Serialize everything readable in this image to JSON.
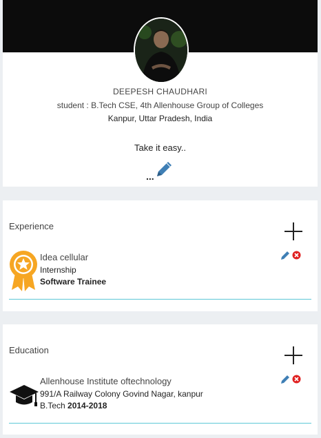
{
  "profile": {
    "name": "DEEPESH CHAUDHARI",
    "headline": "student : B.Tech CSE, 4th Allenhouse Group of Colleges",
    "location": "Kanpur, Uttar Pradesh, India",
    "status": "Take it easy..",
    "more": "..."
  },
  "experience": {
    "title": "Experience",
    "entry": {
      "company": "Idea cellular",
      "type": "Internship",
      "role": "Software Trainee"
    }
  },
  "education": {
    "title": "Education",
    "entry": {
      "institute": "Allenhouse Institute oftechnology",
      "address": "991/A Railway Colony Govind Nagar, kanpur",
      "degree": "B.Tech",
      "years": "2014-2018"
    }
  },
  "icons": {
    "edit": "pencil-icon",
    "delete": "close-circle-icon",
    "add": "plus-icon",
    "experience": "award-badge-icon",
    "education": "graduation-cap-icon"
  },
  "colors": {
    "pencil": "#3f7fb5",
    "delete": "#e02020",
    "badge": "#f6a623",
    "divider": "#5bc7d6",
    "banner": "#0c0c0c"
  }
}
